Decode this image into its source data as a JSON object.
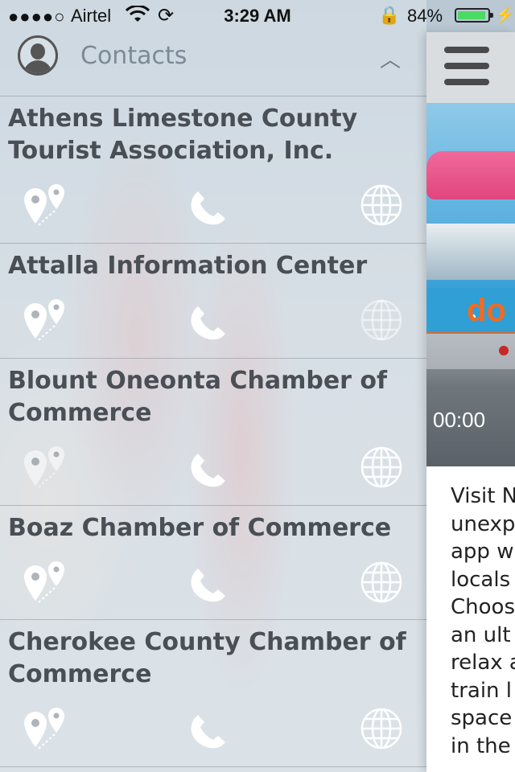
{
  "status_bar": {
    "signal": "●●●●○",
    "carrier": "Airtel",
    "time": "3:29 AM",
    "battery_percent": "84%",
    "battery_level": 0.84
  },
  "header": {
    "title": "Contacts"
  },
  "contacts": [
    {
      "name": "Athens Limestone County Tourist Association, Inc.",
      "map_enabled": true,
      "web_enabled": true
    },
    {
      "name": "Attalla Information Center",
      "map_enabled": true,
      "web_enabled": false
    },
    {
      "name": "Blount Oneonta Chamber of Commerce",
      "map_enabled": false,
      "web_enabled": true
    },
    {
      "name": "Boaz Chamber of Commerce",
      "map_enabled": true,
      "web_enabled": true
    },
    {
      "name": "Cherokee County Chamber of Commerce",
      "map_enabled": true,
      "web_enabled": true
    }
  ],
  "right_panel": {
    "video_time": "00:00",
    "logo_text": "do",
    "text_lines": [
      "Visit N",
      "unexp",
      "app w",
      "locals",
      "Choos",
      "an ult",
      "relax a",
      "train l",
      "space",
      "in the"
    ]
  },
  "colors": {
    "accent_orange": "#f26a21",
    "battery_green": "#4cd964",
    "record_red": "#c62828"
  }
}
